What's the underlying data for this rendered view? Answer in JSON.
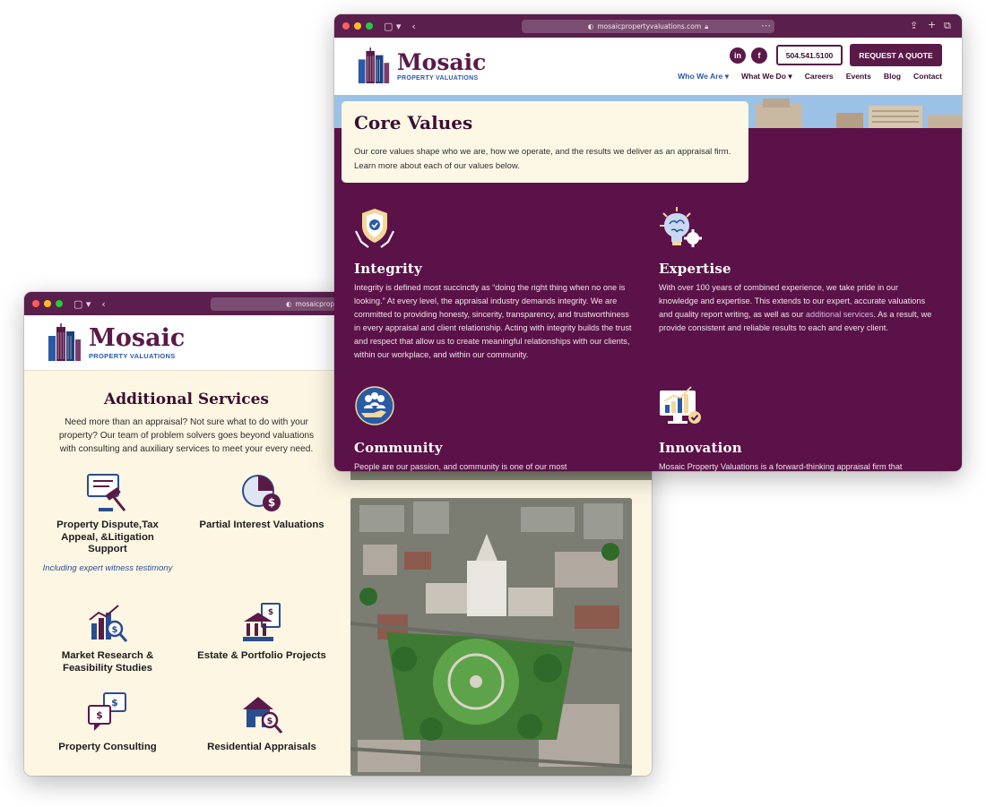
{
  "back_window": {
    "url": "mosaicproper",
    "logo": {
      "word": "Mosaic",
      "sub": "PROPERTY VALUATIONS"
    },
    "section_title": "Additional Services",
    "intro": "Need more than an appraisal? Not sure what to do with your property? Our team of problem solvers goes beyond valuations with consulting and auxiliary services to meet your every need.",
    "services": [
      {
        "label": "Property Dispute,Tax Appeal, &Litigation Support",
        "icon": "gavel-icon",
        "note": "Including expert witness testimony"
      },
      {
        "label": "Partial Interest Valuations",
        "icon": "pie-dollar-icon"
      },
      {
        "label": "Market Research & Feasibility Studies",
        "icon": "chart-magnifier-icon"
      },
      {
        "label": "Estate & Portfolio Projects",
        "icon": "bank-document-icon"
      },
      {
        "label": "Property Consulting",
        "icon": "chat-dollar-icon"
      },
      {
        "label": "Residential Appraisals",
        "icon": "house-magnifier-icon"
      }
    ]
  },
  "front_window": {
    "url": "mosaicpropertyvaluations.com",
    "logo": {
      "word": "Mosaic",
      "sub": "PROPERTY VALUATIONS"
    },
    "phone": "504.541.5100",
    "cta": "REQUEST A QUOTE",
    "nav": [
      "Who We Are",
      "What We Do",
      "Careers",
      "Events",
      "Blog",
      "Contact"
    ],
    "page_title": "Core Values",
    "page_intro": "Our core values shape who we are, how we operate, and the results we deliver as an appraisal firm. Learn more about each of our values below.",
    "values": [
      {
        "title": "Integrity",
        "icon": "shield-hands-icon",
        "text": "Integrity is defined most succinctly as “doing the right thing when no one is looking.” At every level, the appraisal industry demands integrity. We are committed to providing honesty, sincerity, transparency, and trustworthiness in every appraisal and client relationship. Acting with integrity builds the trust and respect that allow us to create meaningful relationships with our clients, within our workplace, and within our community."
      },
      {
        "title": "Expertise",
        "icon": "brain-gear-icon",
        "text_before": "With over 100 years of combined experience, we take pride in our knowledge and expertise. This extends to our expert, accurate valuations and quality report writing, as well as our ",
        "link": "additional services",
        "text_after": ". As a result, we provide consistent and reliable results to each and every client."
      },
      {
        "title": "Community",
        "icon": "people-hand-icon",
        "text": "People are our passion, and community is one of our most"
      },
      {
        "title": "Innovation",
        "icon": "monitor-chart-icon",
        "text": "Mosaic Property Valuations is a forward-thinking appraisal firm that"
      }
    ]
  },
  "colors": {
    "plum": "#5b1248",
    "cream": "#fdf6e3",
    "blue": "#2a5aa6"
  }
}
